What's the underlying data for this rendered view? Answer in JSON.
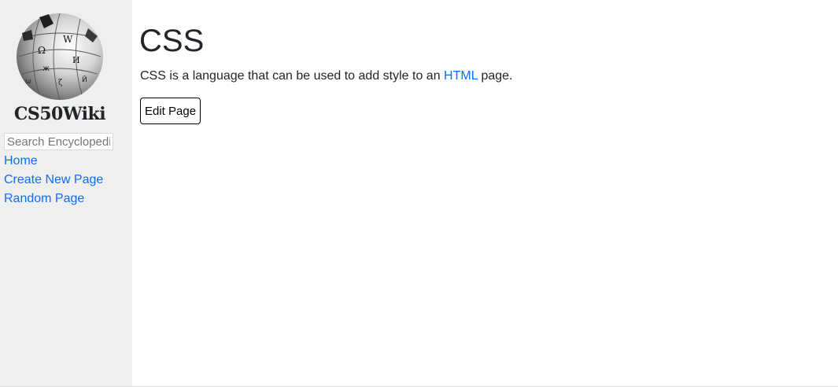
{
  "sidebar": {
    "site_name": "CS50Wiki",
    "search_placeholder": "Search Encyclopedia",
    "nav": [
      {
        "label": "Home"
      },
      {
        "label": "Create New Page"
      },
      {
        "label": "Random Page"
      }
    ]
  },
  "entry": {
    "title": "CSS",
    "body_before": "CSS is a language that can be used to add style to an ",
    "link_text": "HTML",
    "body_after": " page.",
    "edit_button": "Edit Page"
  },
  "colors": {
    "link": "#0d6efd",
    "sidebar_bg": "#efefef",
    "text": "#212529"
  },
  "icons": {
    "logo": "wikipedia-globe-icon"
  }
}
